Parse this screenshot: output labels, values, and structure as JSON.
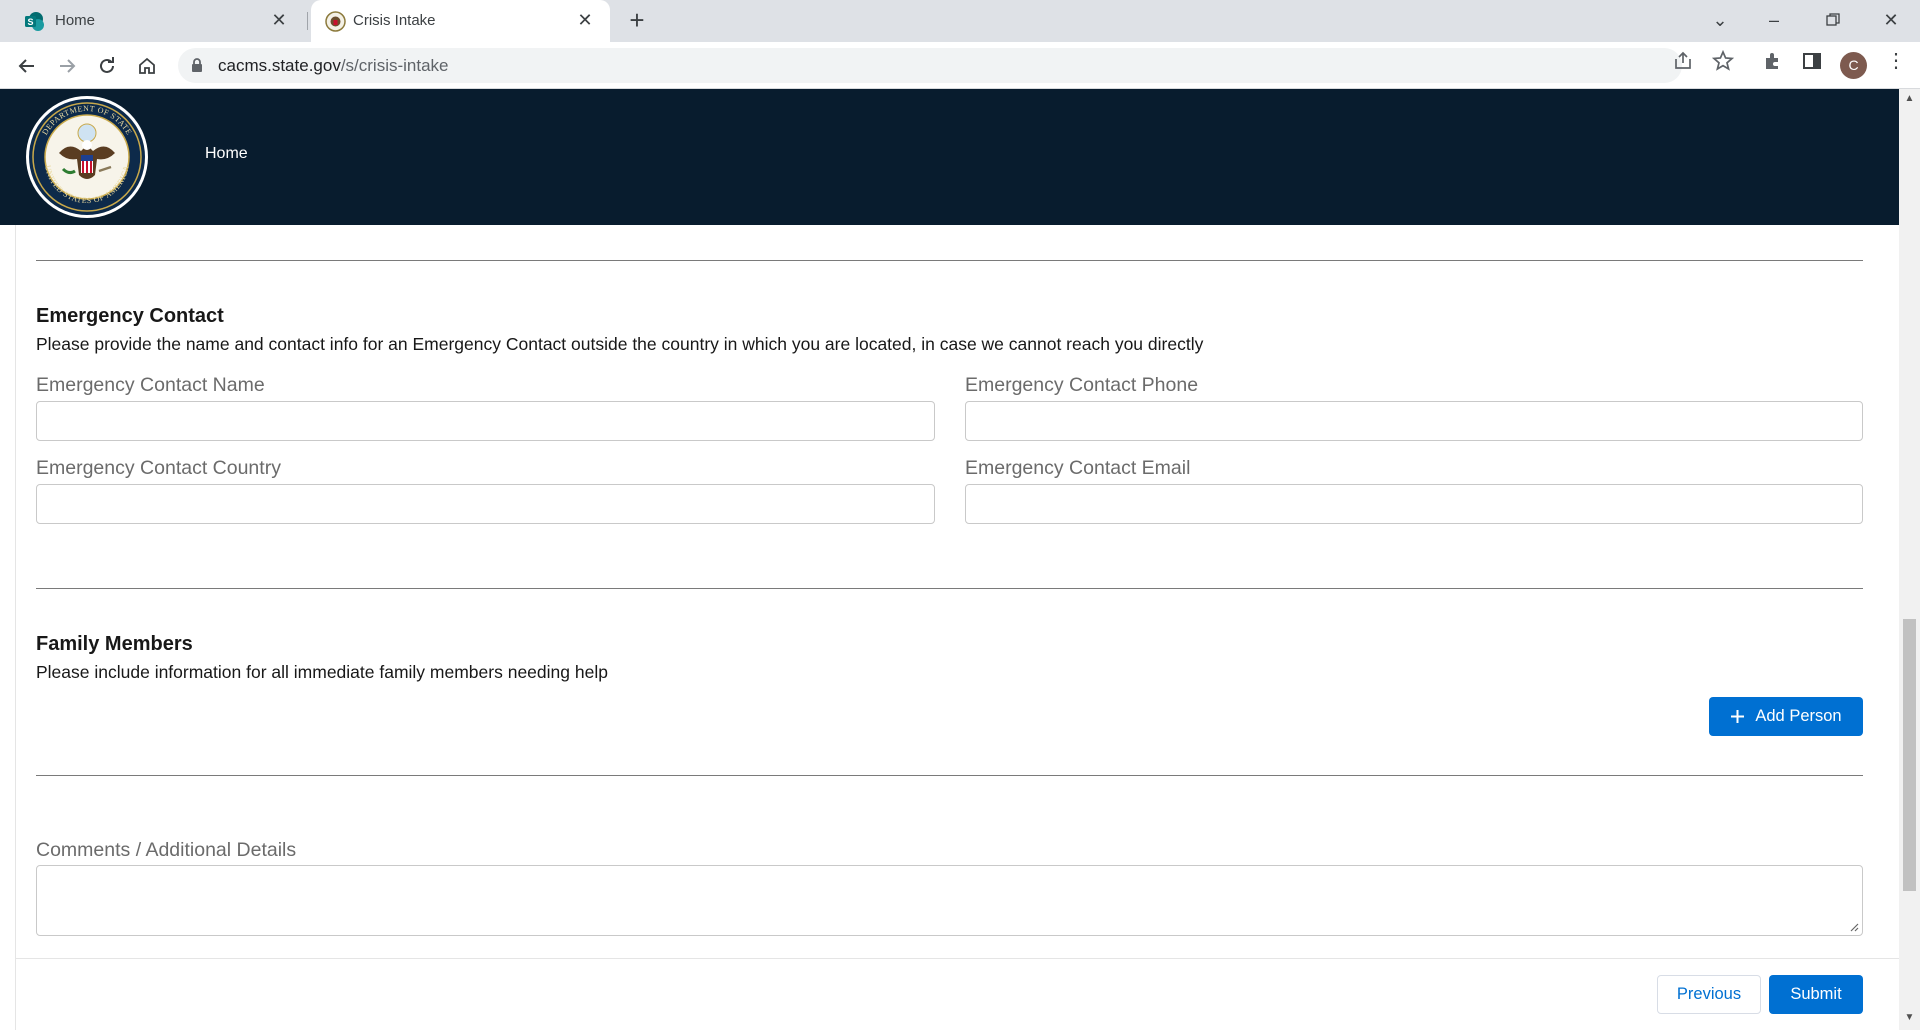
{
  "browser": {
    "tabs": [
      {
        "title": "Home",
        "favicon": "sharepoint-icon"
      },
      {
        "title": "Crisis Intake",
        "favicon": "state-dept-seal-icon"
      }
    ],
    "url_host": "cacms.state.gov",
    "url_path": "/s/crisis-intake",
    "profile_initial": "C"
  },
  "header": {
    "logo_alt": "Department of State Seal",
    "nav_home": "Home",
    "background": "#081c2e"
  },
  "emergency_contact": {
    "title": "Emergency Contact",
    "description": "Please provide the name and contact info for an Emergency Contact outside the country in which you are located, in case we cannot reach you directly",
    "name_label": "Emergency Contact Name",
    "name_value": "",
    "phone_label": "Emergency Contact Phone",
    "phone_value": "",
    "country_label": "Emergency Contact Country",
    "country_value": "",
    "email_label": "Emergency Contact Email",
    "email_value": ""
  },
  "family_members": {
    "title": "Family Members",
    "description": "Please include information for all immediate family members needing help",
    "add_person_label": "Add Person"
  },
  "comments": {
    "label": "Comments / Additional Details",
    "value": ""
  },
  "footer": {
    "previous_label": "Previous",
    "submit_label": "Submit"
  },
  "colors": {
    "brand": "#0070d2",
    "header_bg": "#081c2e"
  }
}
